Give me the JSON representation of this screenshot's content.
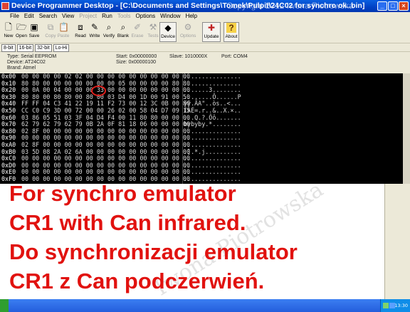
{
  "window": {
    "title": "Device Programmer Desktop - [C:\\Documents and Settings\\Tomek\\Pulpit\\24C02 for synchro ok..bin]",
    "watermark": "Copyright 2012 Iwona Piotrowska"
  },
  "menu": {
    "items": [
      "File",
      "Edit",
      "Search",
      "View",
      "Project",
      "Run",
      "Tools",
      "Options",
      "Window",
      "Help"
    ]
  },
  "toolbar": {
    "buttons": [
      "New",
      "Open",
      "Save",
      "Copy",
      "Paste",
      "Read",
      "Write",
      "Verify",
      "Blank",
      "Erase",
      "Tests",
      "Device",
      "Options",
      "Update",
      "About"
    ],
    "watermark": "Copyright 2012 Iwona Piotrowska"
  },
  "modes": [
    "8-bit",
    "16-bit",
    "32-bit",
    "Lo-Hi"
  ],
  "info": {
    "type": "Type: Serial EEPROM",
    "device": "Device: AT24C02",
    "brand": "Brand: Atmel",
    "start": "Start: 0x00000000",
    "size": "Size: 0x00000100",
    "slave": "Slave: 1010000X",
    "port": "Port: COM4"
  },
  "hex": {
    "rows": [
      {
        "addr": "0x00",
        "bytes": "00 00 00 00 02 02 00 00 00 00 00 00 00 00 00 00",
        "ascii": "................"
      },
      {
        "addr": "0x10",
        "bytes": "80 80 00 00 00 00 00 00 00 05 00 00 00 00 80 80",
        "ascii": "................"
      },
      {
        "addr": "0x20",
        "bytes": "00 0A 00 04 00 00 00 33 00 00 00 00 00 00 00 00",
        "ascii": ".......3........"
      },
      {
        "addr": "0x30",
        "bytes": "80 80 00 80 80 00 80 00 03 D4 00 1D 00 91 00 50",
        "ascii": "........Ô......P"
      },
      {
        "addr": "0x40",
        "bytes": "FF FF 04 C3 41 22 19 11 F2 73 00 12 3C 0B 00 80",
        "ascii": "ÿÿ.ÃA\"..òs..<..."
      },
      {
        "addr": "0x50",
        "bytes": "CC C0 C9 3D 00 72 00 00 26 02 00 58 04 D7 09 15",
        "ascii": "ÌÀÉ=.r..&..X.×.."
      },
      {
        "addr": "0x60",
        "bytes": "03 86 05 51 03 3F 04 D4 F4 00 11 80 80 00 00 00",
        "ascii": "...Q.?.Ôô......."
      },
      {
        "addr": "0x70",
        "bytes": "62 79 62 79 62 79 0B 2A 0F 81 18 06 00 00 00 00",
        "ascii": "bybyby.*........"
      },
      {
        "addr": "0x80",
        "bytes": "02 8F 00 00 00 00 00 00 00 00 00 00 00 00 00 00",
        "ascii": "................"
      },
      {
        "addr": "0x90",
        "bytes": "00 00 00 00 00 00 00 00 00 00 00 00 00 00 00 00",
        "ascii": "................"
      },
      {
        "addr": "0xA0",
        "bytes": "02 8F 00 00 00 00 00 00 00 00 00 00 00 00 00 00",
        "ascii": "................"
      },
      {
        "addr": "0xB0",
        "bytes": "03 5D 08 2A 02 6A 00 00 00 00 00 00 00 00 00 00",
        "ascii": ".].*.j.........."
      },
      {
        "addr": "0xC0",
        "bytes": "00 00 00 00 00 00 00 00 00 00 00 00 00 00 00 00",
        "ascii": "................"
      },
      {
        "addr": "0xD0",
        "bytes": "00 00 00 00 00 00 00 00 00 00 00 00 00 00 00 00",
        "ascii": "................"
      },
      {
        "addr": "0xE0",
        "bytes": "00 00 00 00 00 00 00 00 00 00 00 00 00 00 00 00",
        "ascii": "................"
      },
      {
        "addr": "0xF0",
        "bytes": "00 00 00 00 00 00 00 00 00 00 00 00 00 00 00 00",
        "ascii": "................"
      }
    ]
  },
  "caption": {
    "lines": [
      "For synchro emulator",
      "CR1 with Can infrared.",
      "Do synchronizacji emulator",
      "CR1 z Can podczerwień."
    ],
    "watermark": "Iwona Piotrowska"
  },
  "taskbar": {
    "clock": "13:30"
  },
  "colors": {
    "caption_red": "#e1120f",
    "titlebar_blue": "#0041c4",
    "highlight_circle": "#e0201c"
  },
  "icons": {
    "new": "new-file-icon",
    "open": "open-folder-icon",
    "save": "save-disk-icon",
    "read": "read-chip-icon",
    "write": "write-chip-icon",
    "verify": "verify-magnifier-icon",
    "blank": "blank-check-icon",
    "erase": "erase-icon",
    "device": "device-chip-icon",
    "update": "update-icon",
    "about": "about-question-icon"
  }
}
